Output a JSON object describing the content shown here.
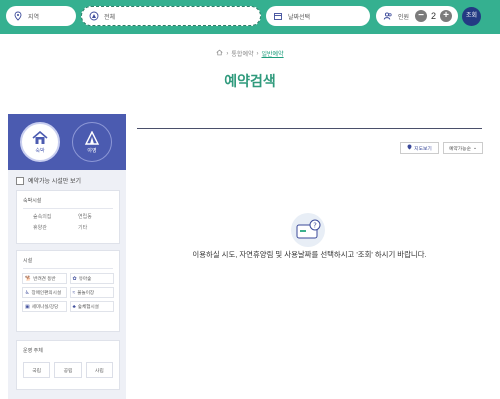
{
  "search": {
    "region_label": "지역",
    "all_label": "전체",
    "date_label": "날짜선택",
    "people_label": "인원",
    "people_count": "2",
    "minus": "−",
    "plus": "+",
    "search_button": "조회"
  },
  "breadcrumb": {
    "home_icon": "home-icon",
    "level1": "통합예약",
    "level2": "일반예약"
  },
  "page": {
    "title": "예약검색"
  },
  "sidebar": {
    "categories": [
      {
        "label": "숙박",
        "icon": "building-icon",
        "selected": true
      },
      {
        "label": "야영",
        "icon": "tent-icon",
        "selected": false
      }
    ],
    "available_only": "예약가능 시설만 보기",
    "lodging": {
      "title": "숙박시설",
      "items": [
        "숲속의집",
        "연립동",
        "휴양관",
        "기타"
      ]
    },
    "facilities": {
      "title": "시설",
      "items": [
        {
          "label": "반려견 동반",
          "icon": "dog-icon"
        },
        {
          "label": "유아숲",
          "icon": "sprout-icon"
        },
        {
          "label": "장애인편의시설",
          "icon": "wheelchair-icon"
        },
        {
          "label": "물놀이장",
          "icon": "pool-icon"
        },
        {
          "label": "세미나실/강당",
          "icon": "seminar-icon"
        },
        {
          "label": "숲체험시설",
          "icon": "tree-icon"
        }
      ]
    },
    "operation": {
      "title": "운영 주체",
      "items": [
        "국립",
        "공립",
        "사립"
      ]
    }
  },
  "toolbar": {
    "map_view": "지도보기",
    "sort_select": "예약가능순"
  },
  "empty": {
    "message": "이용하실 시도, 자연휴양림 및 사용날짜를 선택하시고 '조회' 하시기 바랍니다.",
    "icon": "reservation-card-icon"
  },
  "colors": {
    "topbar": "#35b090",
    "accent": "#2f9a7c",
    "sidebar_head": "#4b5bb0",
    "search_button": "#233a83"
  }
}
